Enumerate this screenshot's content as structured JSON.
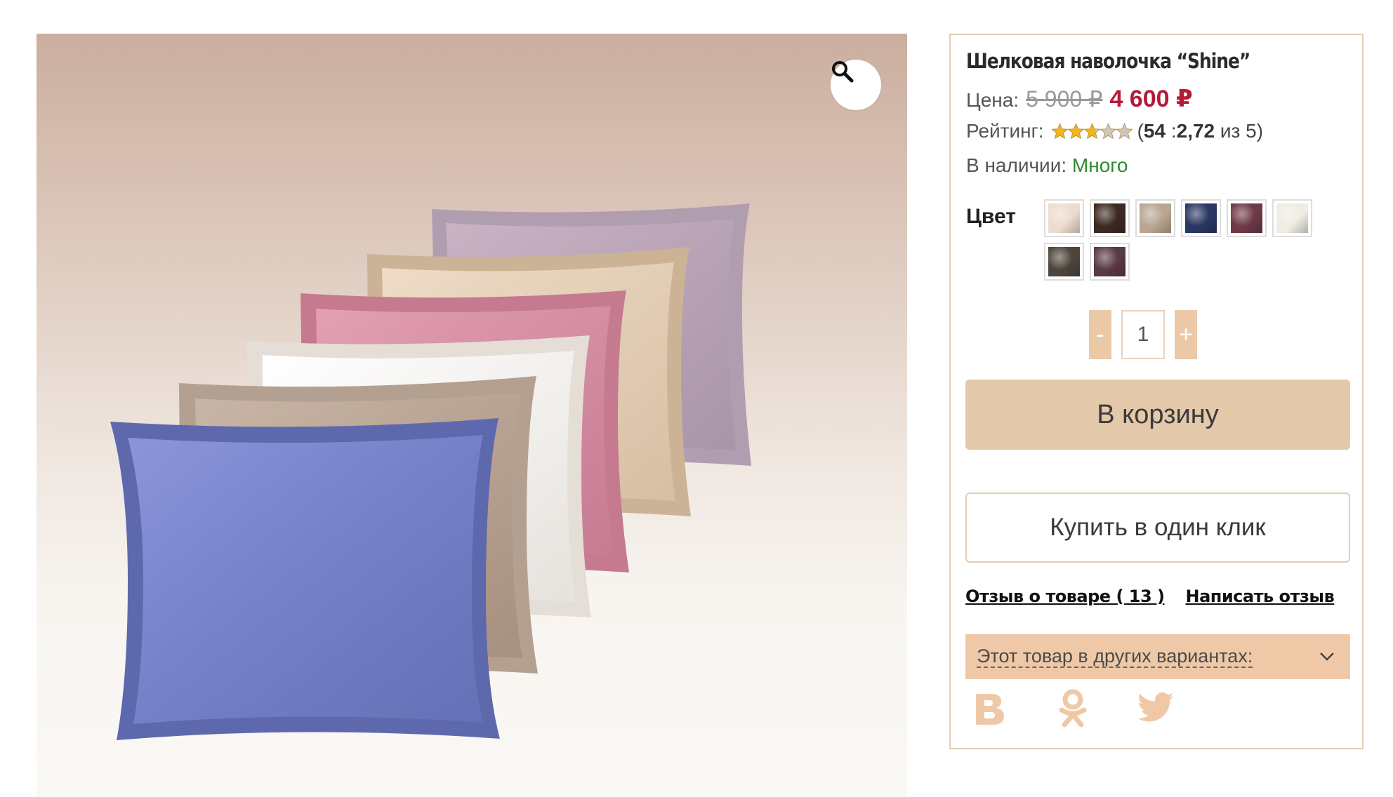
{
  "product": {
    "title": "Шелковая наволочка “Shine”",
    "image_alt": "Шелковая наволочка Shine — палитра цветов"
  },
  "price": {
    "label": "Цена:",
    "old": "5 900 ₽",
    "new": "4 600 ₽"
  },
  "rating": {
    "label": "Рейтинг:",
    "open_paren": "(",
    "votes": "54",
    "separator": " :",
    "score": "2,72",
    "suffix": " из 5)",
    "value": 2.72,
    "max": 5
  },
  "stock": {
    "label": "В наличии:",
    "value": "Много"
  },
  "color": {
    "label": "Цвет",
    "swatches": [
      {
        "name": "Пудровый",
        "hex": "#ecdcd0"
      },
      {
        "name": "Шоколад",
        "hex": "#3d2a22"
      },
      {
        "name": "Капучино",
        "hex": "#b9a690"
      },
      {
        "name": "Синий",
        "hex": "#2a3763"
      },
      {
        "name": "Бордо",
        "hex": "#6e3a48"
      },
      {
        "name": "Молочный",
        "hex": "#efece3"
      },
      {
        "name": "Графит",
        "hex": "#4e463d"
      },
      {
        "name": "Сливовый",
        "hex": "#5a3a46"
      }
    ]
  },
  "quantity": {
    "minus": "-",
    "plus": "+",
    "value": "1"
  },
  "buttons": {
    "cart": "В корзину",
    "one_click": "Купить в один клик"
  },
  "links": {
    "reviews": "Отзыв о товаре ( 13 )",
    "write_review": "Написать отзыв"
  },
  "variants": {
    "label": "Этот товар в других вариантах:"
  },
  "social": [
    {
      "name": "vk-icon"
    },
    {
      "name": "odnoklassniki-icon"
    },
    {
      "name": "twitter-icon"
    }
  ],
  "colors": {
    "accent": "#e3c8aa",
    "accent_strong": "#efc9a7",
    "price_red": "#b51a3a",
    "in_stock_green": "#2e8b2e",
    "panel_border": "#e3cdb1"
  }
}
